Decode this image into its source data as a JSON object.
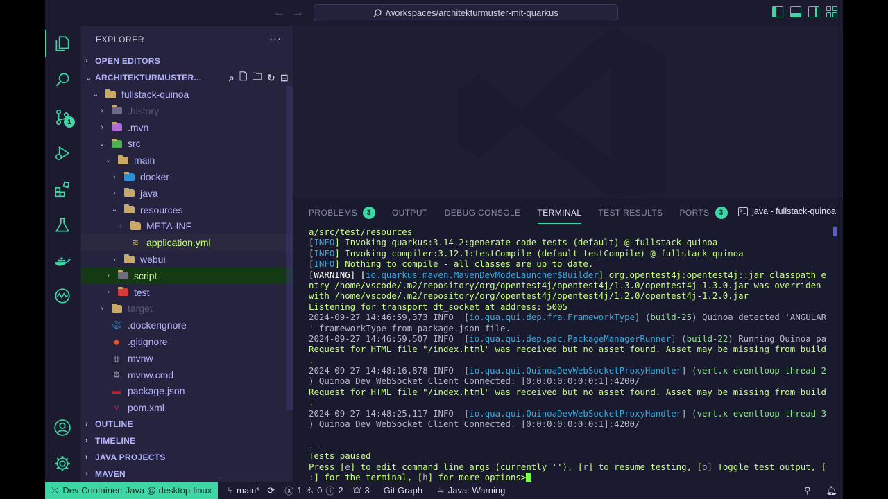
{
  "title_bar": {
    "back_icon": "arrow-left-icon",
    "forward_icon": "arrow-right-icon",
    "search_text": "/workspaces/architekturmuster-mit-quarkus"
  },
  "activity_bar": {
    "source_control_badge": "1"
  },
  "explorer": {
    "title": "EXPLORER",
    "more": "···",
    "sections": {
      "open_editors": "OPEN EDITORS",
      "project": "ARCHITEKTURMUSTER...",
      "outline": "OUTLINE",
      "timeline": "TIMELINE",
      "java_projects": "JAVA PROJECTS",
      "maven": "MAVEN"
    },
    "tree": [
      {
        "label": "fullstack-quinoa",
        "twisty": "⌄",
        "icon": "folder-open-icon"
      },
      {
        "label": ".history",
        "twisty": "›",
        "icon": "folder-history-icon"
      },
      {
        "label": ".mvn",
        "twisty": "›",
        "icon": "folder-maven-icon"
      },
      {
        "label": "src",
        "twisty": "⌄",
        "icon": "folder-src-icon"
      },
      {
        "label": "main",
        "twisty": "⌄",
        "icon": "folder-open-icon"
      },
      {
        "label": "docker",
        "twisty": "›",
        "icon": "folder-docker-icon"
      },
      {
        "label": "java",
        "twisty": "›",
        "icon": "folder-icon"
      },
      {
        "label": "resources",
        "twisty": "⌄",
        "icon": "folder-open-icon"
      },
      {
        "label": "META-INF",
        "twisty": "›",
        "icon": "folder-icon"
      },
      {
        "label": "application.yml",
        "twisty": "",
        "icon": "yaml-file-icon"
      },
      {
        "label": "webui",
        "twisty": "›",
        "icon": "folder-icon"
      },
      {
        "label": "script",
        "twisty": "›",
        "icon": "folder-script-icon"
      },
      {
        "label": "test",
        "twisty": "›",
        "icon": "folder-test-icon"
      },
      {
        "label": "target",
        "twisty": "›",
        "icon": "folder-icon"
      },
      {
        "label": ".dockerignore",
        "twisty": "",
        "icon": "docker-file-icon"
      },
      {
        "label": ".gitignore",
        "twisty": "",
        "icon": "git-file-icon"
      },
      {
        "label": "mvnw",
        "twisty": "",
        "icon": "file-icon"
      },
      {
        "label": "mvnw.cmd",
        "twisty": "",
        "icon": "gear-file-icon"
      },
      {
        "label": "package.json",
        "twisty": "",
        "icon": "npm-file-icon"
      },
      {
        "label": "pom.xml",
        "twisty": "",
        "icon": "maven-file-icon"
      }
    ]
  },
  "panel": {
    "tabs": {
      "problems": "PROBLEMS",
      "problems_badge": "3",
      "output": "OUTPUT",
      "debug_console": "DEBUG CONSOLE",
      "terminal": "TERMINAL",
      "test_results": "TEST RESULTS",
      "ports": "PORTS",
      "ports_badge": "3"
    },
    "terminal_name": "java - fullstack-quinoa",
    "lines": [
      [
        [
          "a/src/test/resources",
          ""
        ]
      ],
      [
        [
          "[",
          "w"
        ],
        [
          "INFO",
          "c"
        ],
        [
          "] Invoking quarkus:3.14.2:generate-code-tests (default) @ fullstack-quinoa",
          ""
        ]
      ],
      [
        [
          "[",
          "w"
        ],
        [
          "INFO",
          "c"
        ],
        [
          "] Invoking compiler:3.12.1:testCompile (default-testCompile) @ fullstack-quinoa",
          ""
        ]
      ],
      [
        [
          "[",
          "w"
        ],
        [
          "INFO",
          "c"
        ],
        [
          "] Nothing to compile - all classes are up to date.",
          ""
        ]
      ],
      [
        [
          "[",
          "w"
        ],
        [
          "WARNING",
          "w"
        ],
        [
          "] [",
          "w"
        ],
        [
          "io.quarkus.maven.MavenDevModeLauncher$Builder",
          "c"
        ],
        [
          "] org.opentest4j:opentest4j::jar classpath e",
          ""
        ]
      ],
      [
        [
          "ntry /home/vscode/.m2/repository/org/opentest4j/opentest4j/1.3.0/opentest4j-1.3.0.jar was overriden",
          ""
        ]
      ],
      [
        [
          "with /home/vscode/.m2/repository/org/opentest4j/opentest4j/1.2.0/opentest4j-1.2.0.jar",
          ""
        ]
      ],
      [
        [
          "Listening for transport dt_socket at address: 5005",
          ""
        ]
      ],
      [
        [
          "2024-09-27 14:46:59,373 ",
          "r"
        ],
        [
          "INFO  ",
          "r"
        ],
        [
          "[",
          "r"
        ],
        [
          "io.qua.qui.dep.fra.FrameworkType",
          "c"
        ],
        [
          "] (",
          "r"
        ],
        [
          "build-25",
          "g"
        ],
        [
          ") Quinoa detected 'ANGULAR",
          "r"
        ]
      ],
      [
        [
          "' frameworkType from package.json file.",
          "r"
        ]
      ],
      [
        [
          "2024-09-27 14:46:59,507 ",
          "r"
        ],
        [
          "INFO  ",
          "r"
        ],
        [
          "[",
          "r"
        ],
        [
          "io.qua.qui.dep.pac.PackageManagerRunner",
          "c"
        ],
        [
          "] (",
          "r"
        ],
        [
          "build-22",
          "g"
        ],
        [
          ") Running Quinoa pa",
          "r"
        ]
      ],
      [
        [
          "Request for HTML file \"/index.html\" was received but no asset found. Asset may be missing from build",
          ""
        ]
      ],
      [
        [
          ".",
          ""
        ]
      ],
      [
        [
          "2024-09-27 14:48:16,878 ",
          "r"
        ],
        [
          "INFO  ",
          "r"
        ],
        [
          "[",
          "r"
        ],
        [
          "io.qua.qui.QuinoaDevWebSocketProxyHandler",
          "c"
        ],
        [
          "] (",
          "r"
        ],
        [
          "vert.x-eventloop-thread-2",
          "g"
        ]
      ],
      [
        [
          ") Quinoa Dev WebSocket Client Connected: [0:0:0:0:0:0:0:1]:4200/",
          "r"
        ]
      ],
      [
        [
          "Request for HTML file \"/index.html\" was received but no asset found. Asset may be missing from build",
          ""
        ]
      ],
      [
        [
          ".",
          ""
        ]
      ],
      [
        [
          "2024-09-27 14:48:25,117 ",
          "r"
        ],
        [
          "INFO  ",
          "r"
        ],
        [
          "[",
          "r"
        ],
        [
          "io.qua.qui.QuinoaDevWebSocketProxyHandler",
          "c"
        ],
        [
          "] (",
          "r"
        ],
        [
          "vert.x-eventloop-thread-3",
          "g"
        ]
      ],
      [
        [
          ") Quinoa Dev WebSocket Client Connected: [0:0:0:0:0:0:0:1]:4200/",
          "r"
        ]
      ],
      [
        [
          "",
          ""
        ]
      ],
      [
        [
          "--",
          ""
        ]
      ],
      [
        [
          "Tests paused",
          ""
        ]
      ],
      [
        [
          "Press [",
          ""
        ],
        [
          "e",
          "r"
        ],
        [
          "] to edit command line args (currently ''), [",
          ""
        ],
        [
          "r",
          "r"
        ],
        [
          "] to resume testing, [",
          ""
        ],
        [
          "o",
          "r"
        ],
        [
          "] Toggle test output, [",
          ""
        ]
      ],
      [
        [
          ":",
          "r"
        ],
        [
          "] for the terminal, [",
          ""
        ],
        [
          "h",
          "r"
        ],
        [
          "] for more options>",
          ""
        ]
      ]
    ]
  },
  "status_bar": {
    "remote": "Dev Container: Java @ desktop-linux",
    "branch": "main*",
    "errors": "1",
    "warnings": "0",
    "info": "2",
    "ports": "3",
    "git_graph": "Git Graph",
    "java_status": "Java: Warning"
  },
  "colors": {
    "accent": "#3ed6a5",
    "sidebar_bg": "#25233e",
    "editor_bg": "#1e1d34",
    "terminal_text": "#c7ff7e"
  }
}
